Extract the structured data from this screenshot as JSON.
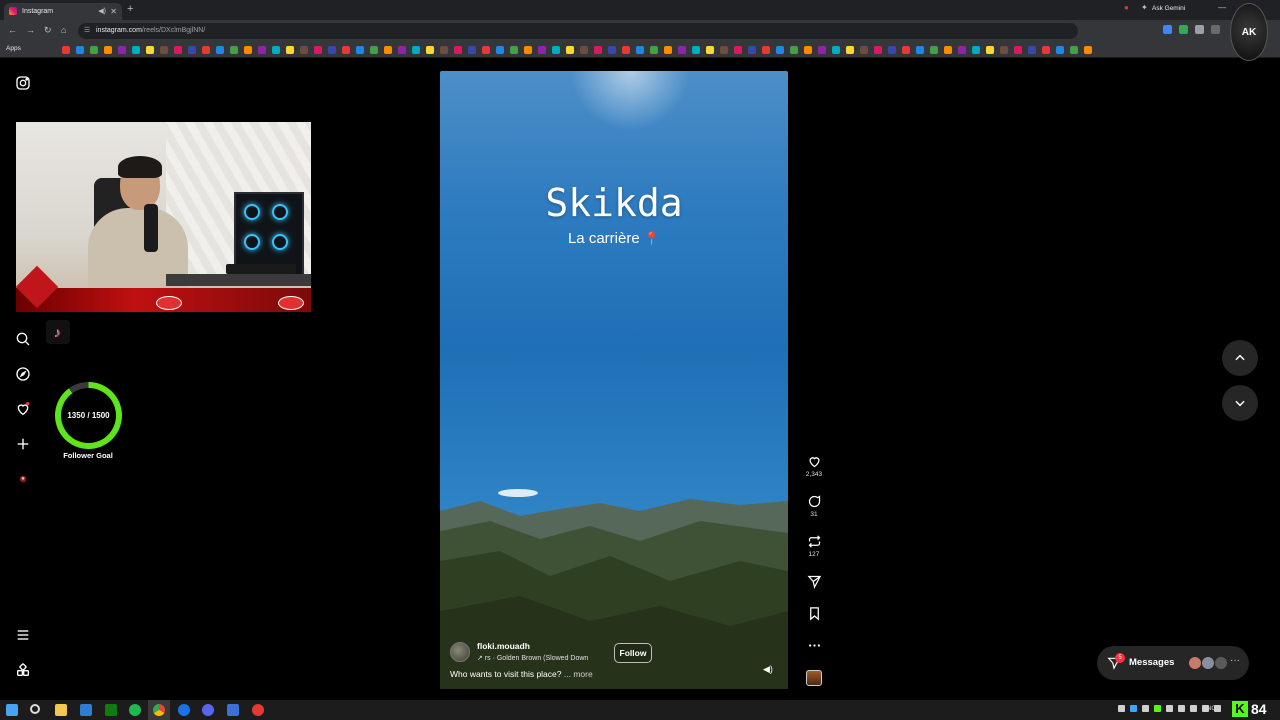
{
  "browser": {
    "tab_title": "Instagram",
    "new_tab": "+",
    "url_host": "instagram.com",
    "url_path": "/reels/DXclmBgjlNN/",
    "ask_gemini": "Ask Gemini",
    "bookmarks_apps": "Apps"
  },
  "profile_logo_text": "AK",
  "ig_nav": [
    "instagram-logo",
    "search",
    "explore",
    "notifications",
    "create",
    "profile",
    "more",
    "also-from-meta"
  ],
  "overlay": {
    "follower_goal_value": "1350 / 1500",
    "follower_goal_label": "Follower Goal",
    "follower_goal_progress": 0.9
  },
  "reel": {
    "title": "Skikda",
    "subtitle": "La carrière",
    "username": "floki.mouadh",
    "song": "rs · Golden Brown (Slowed Down",
    "follow_label": "Follow",
    "caption": "Who wants to visit this place?",
    "caption_more": "... more",
    "likes": "2,343",
    "comments": "31",
    "reposts": "127"
  },
  "messages": {
    "label": "Messages",
    "unread": "5"
  },
  "stream": {
    "kick_logo": "K",
    "viewer_count": "84"
  },
  "taskbar": {
    "lang": "ENG"
  },
  "colors": {
    "goal_ring": "#5fe31a",
    "badge": "#ff3040",
    "kick": "#53fc18"
  }
}
